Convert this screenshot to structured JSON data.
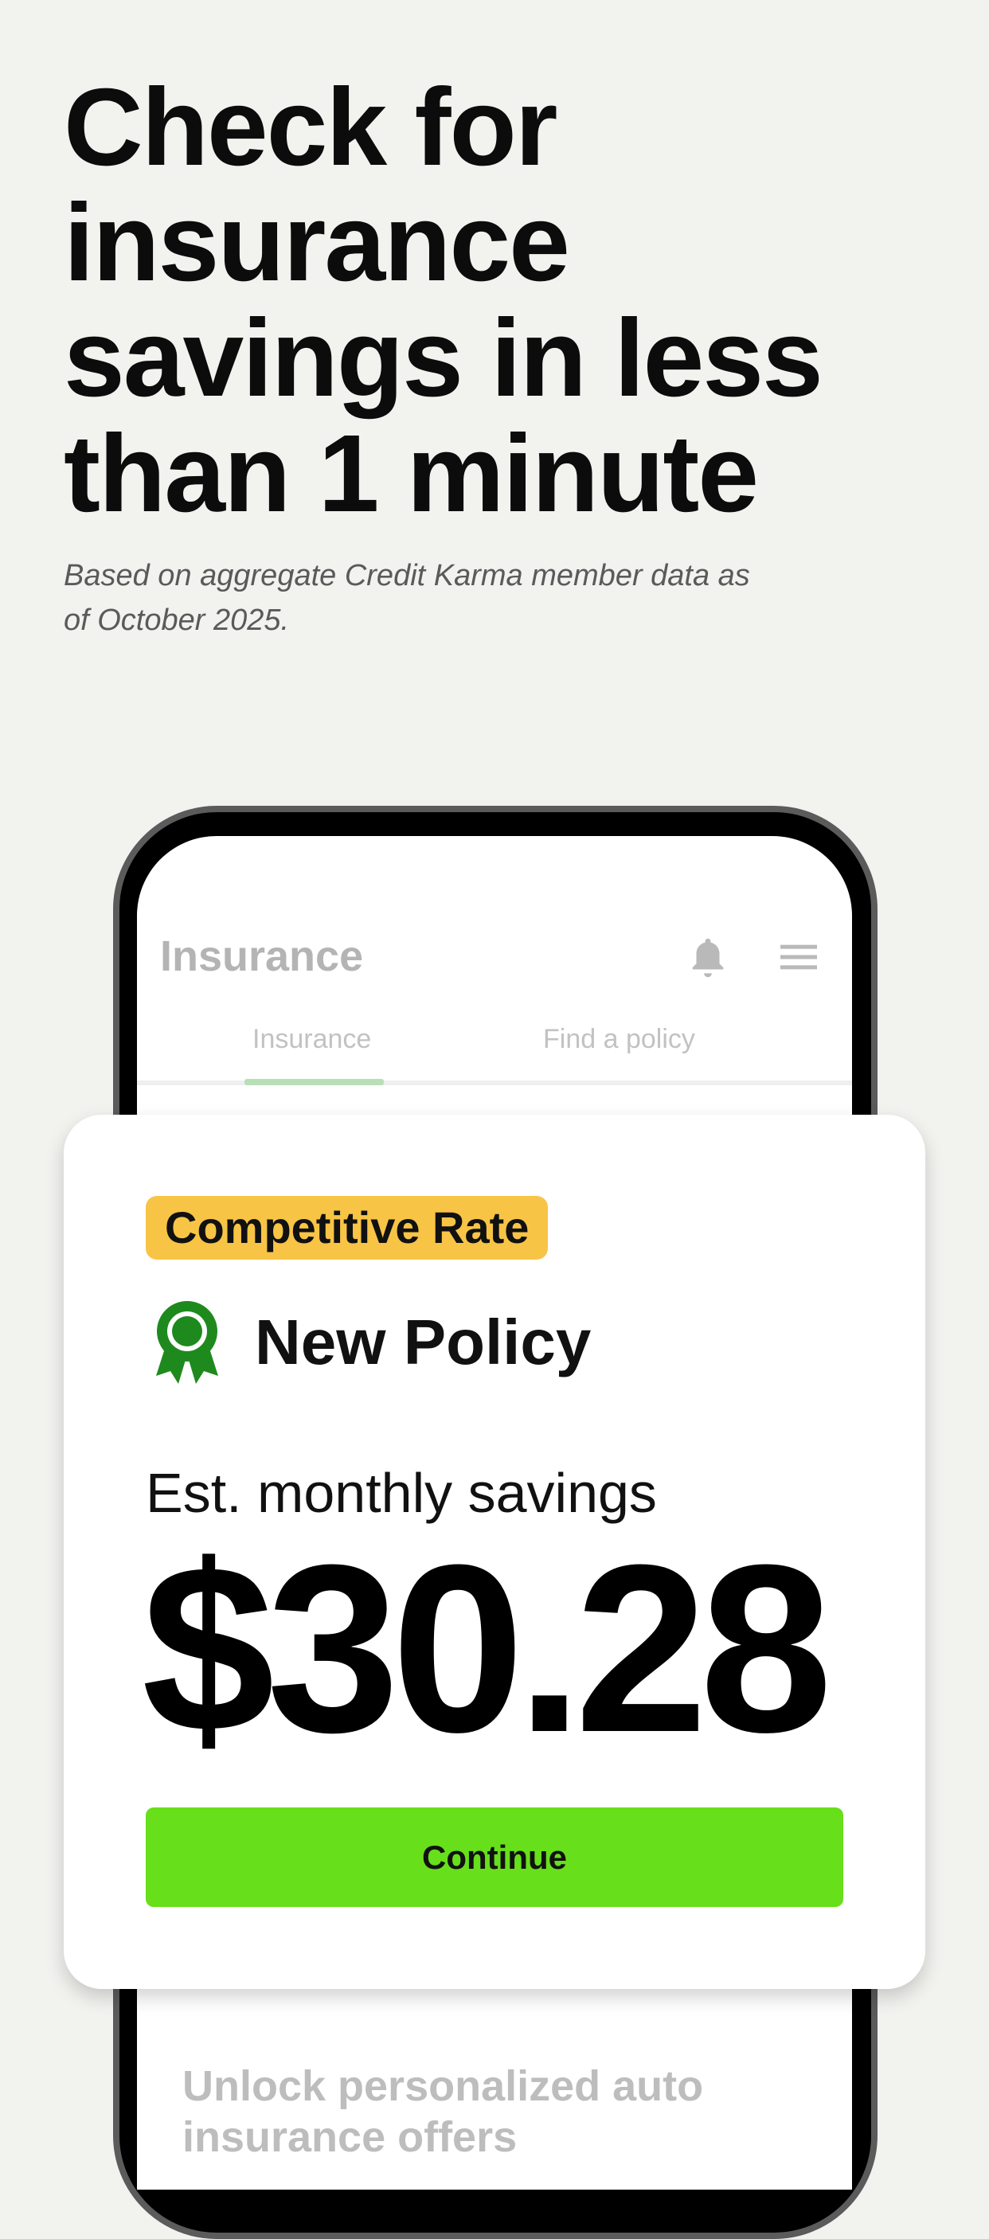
{
  "hero": {
    "headline": "Check for insurance savings in less than 1 minute",
    "disclaimer": "Based on aggregate Credit Karma member data as of October 2025."
  },
  "app": {
    "title": "Insurance",
    "bell_icon": "bell-icon",
    "menu_icon": "hamburger-menu-icon",
    "tabs": [
      {
        "label": "Insurance",
        "active": true
      },
      {
        "label": "Find a policy",
        "active": false
      }
    ],
    "bottom_text": "Unlock personalized auto insurance offers"
  },
  "card": {
    "badge": "Competitive Rate",
    "badge_color": "#f8c446",
    "policy_icon": "award-ribbon-icon",
    "policy_title": "New Policy",
    "savings_label": "Est. monthly savings",
    "amount": "$30.28",
    "continue_label": "Continue",
    "button_color": "#67df1a"
  }
}
